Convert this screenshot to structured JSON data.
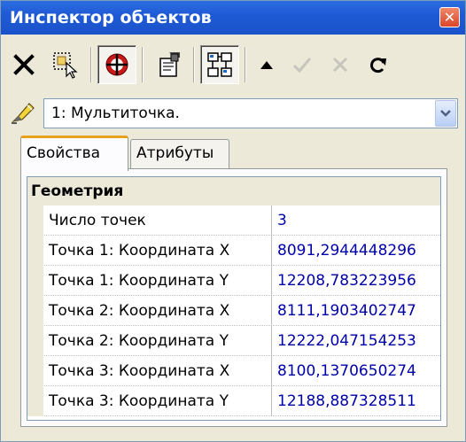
{
  "window": {
    "title": "Инспектор объектов"
  },
  "toolbar": {
    "buttons": [
      {
        "icon": "delete-x-icon"
      },
      {
        "icon": "select-area-icon"
      },
      {
        "icon": "target-crosshair-icon",
        "pressed": true
      },
      {
        "icon": "properties-card-icon"
      },
      {
        "icon": "tree-structure-icon",
        "pressed": true
      },
      {
        "icon": "move-up-triangle-icon"
      },
      {
        "icon": "apply-check-icon",
        "disabled": true
      },
      {
        "icon": "cancel-x-icon",
        "disabled": true
      },
      {
        "icon": "refresh-icon"
      }
    ]
  },
  "object_select": {
    "value": "1: Мультиточка."
  },
  "tabs": [
    {
      "label": "Свойства",
      "active": true
    },
    {
      "label": "Атрибуты",
      "active": false
    }
  ],
  "grid": {
    "section": "Геометрия",
    "rows": [
      {
        "name": "Число точек",
        "value": "3"
      },
      {
        "name": "Точка 1: Координата X",
        "value": "8091,2944448296"
      },
      {
        "name": "Точка 1: Координата Y",
        "value": "12208,783223956"
      },
      {
        "name": "Точка 2: Координата X",
        "value": "8111,1903402747"
      },
      {
        "name": "Точка 2: Координата Y",
        "value": "12222,047154253"
      },
      {
        "name": "Точка 3: Координата X",
        "value": "8100,1370650274"
      },
      {
        "name": "Точка 3: Координата Y",
        "value": "12188,887328511"
      }
    ]
  },
  "colors": {
    "titlebar": "#1f5ad6",
    "value_text": "#0000a8",
    "active_tab_accent": "#e6a21a"
  }
}
